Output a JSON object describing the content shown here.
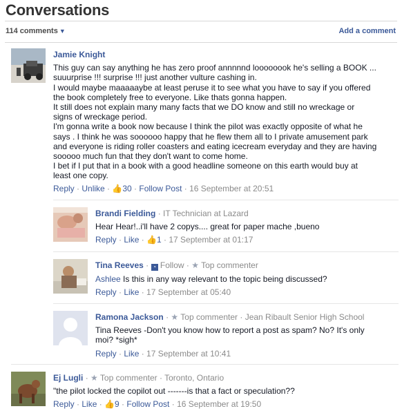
{
  "header": {
    "title": "Conversations",
    "count": "114 comments",
    "add": "Add a comment"
  },
  "c1": {
    "name": "Jamie Knight",
    "lines": [
      "This guy can say anything he has zero proof annnnnd loooooook he's selling a BOOK ...",
      "suuurprise !!! surprise !!! just another vulture cashing in.",
      "I would maybe maaaaaybe at least peruse it to see what you have to say if you offered",
      "the book completely free to everyone. Like thats gonna happen.",
      "It still does not explain many many facts that we DO know and still no wreckage or",
      "signs of wreckage period.",
      "I'm gonna write a book now because I think the pilot was exactly opposite of what he",
      "says . I think he was soooooo happy that he flew them all to I private amusement park",
      "and everyone is riding roller coasters and eating icecream everyday and they are having",
      "sooooo much fun that they don't want to come home.",
      "I bet if I put that in a book with a good headline someone on this earth would buy at",
      "least one copy."
    ],
    "reply": "Reply",
    "unlike": "Unlike",
    "likes": "30",
    "follow": "Follow Post",
    "date": "16 September at 20:51"
  },
  "r1": {
    "name": "Brandi Fielding",
    "title": "IT Technician",
    "at": "at",
    "company": "Lazard",
    "text": "Hear Hear!..i'll have 2 copys.... great for paper mache ,bueno",
    "reply": "Reply",
    "like": "Like",
    "likes": "1",
    "date": "17 September at 01:17"
  },
  "r2": {
    "name": "Tina Reeves",
    "follow": "Follow",
    "badge": "Top commenter",
    "mention": "Ashlee",
    "text": " Is this in any way relevant to the topic being discussed?",
    "reply": "Reply",
    "like": "Like",
    "date": "17 September at 05:40"
  },
  "r3": {
    "name": "Ramona Jackson",
    "badge": "Top commenter",
    "school": "Jean Ribault Senior High School",
    "line1": "Tina Reeves -Don't you know how to report a post as spam? No? It's only",
    "line2": "moi? *sigh*",
    "reply": "Reply",
    "like": "Like",
    "date": "17 September at 10:41"
  },
  "c2": {
    "name": "Ej Lugli",
    "badge": "Top commenter",
    "location": "Toronto, Ontario",
    "text": "\"the pilot locked the copilot out -------is that a fact or speculation??",
    "reply": "Reply",
    "like": "Like",
    "likes": "9",
    "follow": "Follow Post",
    "date": "16 September at 19:50"
  },
  "colors": {
    "link": "#3b5998",
    "meta": "#8a8a8a",
    "text": "#141823"
  }
}
